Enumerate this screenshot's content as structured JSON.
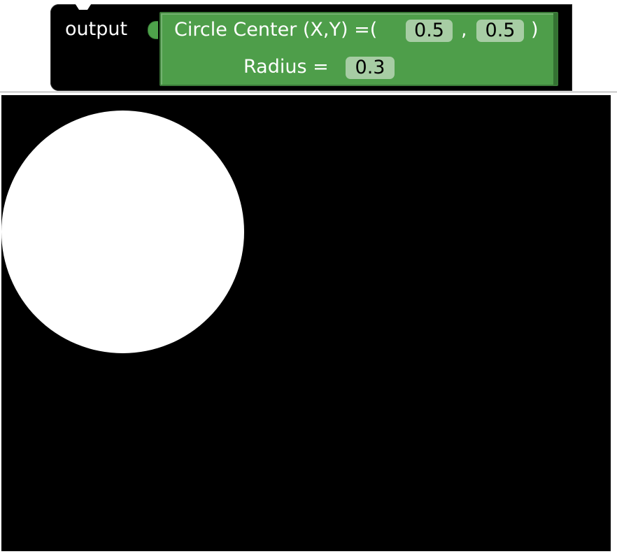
{
  "block": {
    "label": "output",
    "circle_block": {
      "center_label": "Circle Center (X,Y) =(",
      "separator": ",",
      "close_paren": ")",
      "x_value": "0.5",
      "y_value": "0.5",
      "radius_label": "Radius =",
      "radius_value": "0.3",
      "color": "#4e9e4a"
    }
  },
  "canvas": {
    "background": "#000000",
    "circle_color": "#ffffff"
  }
}
